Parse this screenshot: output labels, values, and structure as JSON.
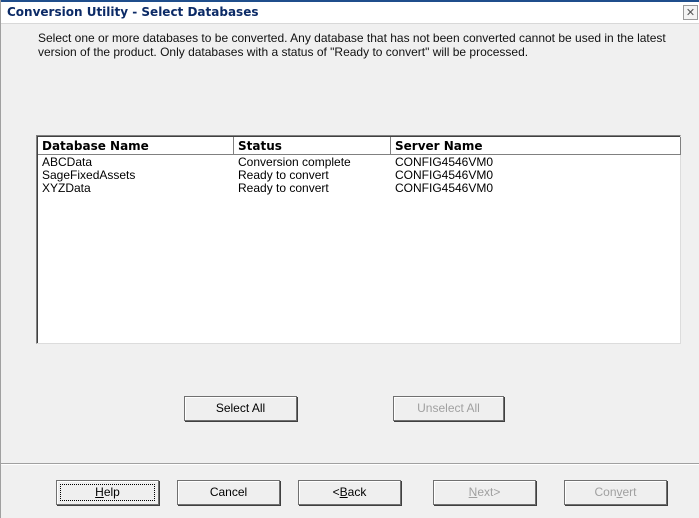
{
  "window": {
    "title": "Conversion Utility - Select Databases",
    "close_glyph": "✕"
  },
  "instructions": "Select one or more databases to be converted. Any database that has not been converted cannot be used in the latest version of the product. Only databases with a status of \"Ready to convert\" will be processed.",
  "table": {
    "columns": [
      "Database Name",
      "Status",
      "Server Name"
    ],
    "rows": [
      [
        "ABCData",
        "Conversion complete",
        "CONFIG4546VM0"
      ],
      [
        "SageFixedAssets",
        "Ready to convert",
        "CONFIG4546VM0"
      ],
      [
        "XYZData",
        "Ready to convert",
        "CONFIG4546VM0"
      ]
    ]
  },
  "selection_buttons": {
    "select_all": "Select All",
    "unselect_all": "Unselect All"
  },
  "footer_buttons": {
    "help_pre": "",
    "help_mn": "H",
    "help_post": "elp",
    "cancel": "Cancel",
    "back_pre": "<",
    "back_mn": "B",
    "back_post": "ack",
    "next_pre": "",
    "next_mn": "N",
    "next_post": "ext>",
    "convert_pre": "Con",
    "convert_mn": "v",
    "convert_post": "ert"
  },
  "colors": {
    "title_text": "#0b2a66",
    "window_bg": "#f0f0f0",
    "disabled_text": "#a0a0a0"
  }
}
